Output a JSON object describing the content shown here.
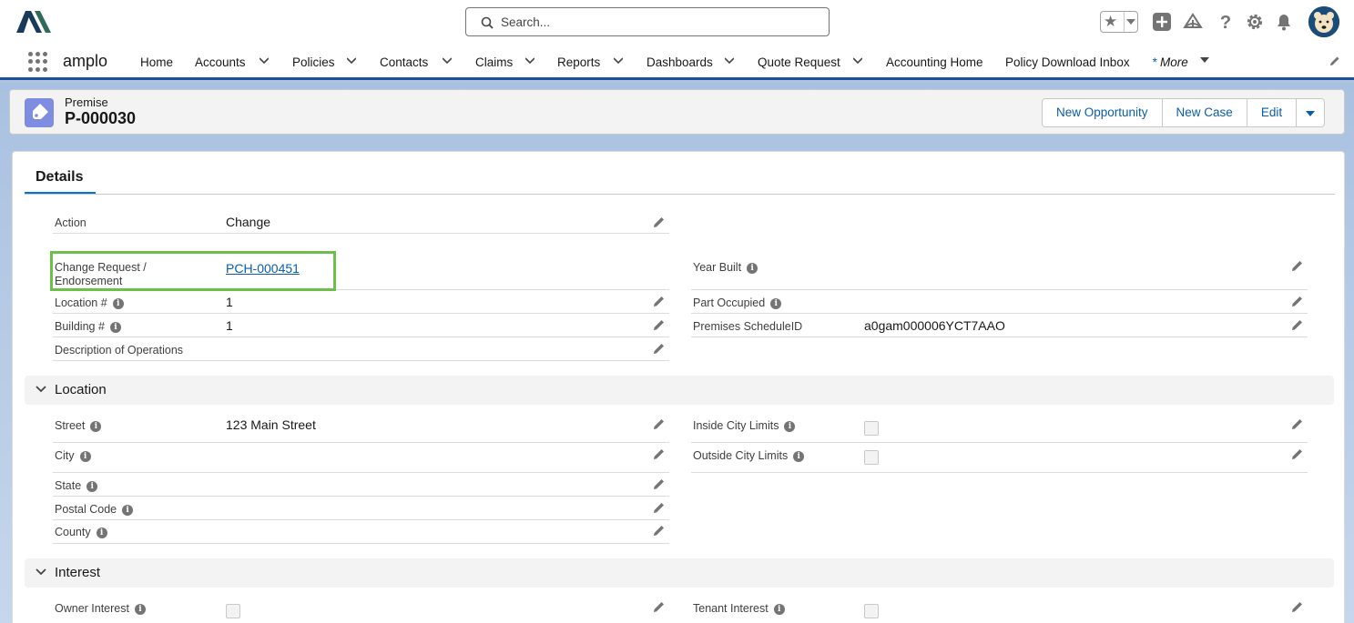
{
  "header": {
    "search_placeholder": "Search..."
  },
  "nav": {
    "app_name": "amplo",
    "items": [
      {
        "label": "Home"
      },
      {
        "label": "Accounts"
      },
      {
        "label": "Policies"
      },
      {
        "label": "Contacts"
      },
      {
        "label": "Claims"
      },
      {
        "label": "Reports"
      },
      {
        "label": "Dashboards"
      },
      {
        "label": "Quote Request"
      },
      {
        "label": "Accounting Home"
      },
      {
        "label": "Policy Download Inbox"
      }
    ],
    "more_star": "*",
    "more_label": "More"
  },
  "record": {
    "object_type": "Premise",
    "name": "P-000030",
    "buttons": {
      "new_opportunity": "New Opportunity",
      "new_case": "New Case",
      "edit": "Edit"
    }
  },
  "details": {
    "tab_label": "Details",
    "fields": {
      "action": {
        "label": "Action",
        "value": "Change"
      },
      "change_request": {
        "label_line1": "Change Request /",
        "label_line2": "Endorsement",
        "value": "PCH-000451"
      },
      "location_num": {
        "label": "Location #",
        "value": "1"
      },
      "building_num": {
        "label": "Building #",
        "value": "1"
      },
      "description": {
        "label": "Description of Operations",
        "value": ""
      },
      "year_built": {
        "label": "Year Built",
        "value": ""
      },
      "part_occupied": {
        "label": "Part Occupied",
        "value": ""
      },
      "premises_schedule": {
        "label": "Premises ScheduleID",
        "value": "a0gam000006YCT7AAO"
      }
    }
  },
  "location_section": {
    "title": "Location",
    "fields": {
      "street": {
        "label": "Street",
        "value": "123 Main Street"
      },
      "city": {
        "label": "City",
        "value": ""
      },
      "state": {
        "label": "State",
        "value": ""
      },
      "postal_code": {
        "label": "Postal Code",
        "value": ""
      },
      "county": {
        "label": "County",
        "value": ""
      },
      "inside_city_limits": {
        "label": "Inside City Limits",
        "checked": false
      },
      "outside_city_limits": {
        "label": "Outside City Limits",
        "checked": false
      }
    }
  },
  "interest_section": {
    "title": "Interest",
    "fields": {
      "owner_interest": {
        "label": "Owner Interest",
        "checked": false
      },
      "tenant_interest": {
        "label": "Tenant Interest",
        "checked": false
      }
    }
  },
  "colors": {
    "brand_blue": "#0b5cab",
    "nav_border": "#1b5297",
    "highlight_green": "#6cc04a",
    "premise_icon": "#7f8de1"
  }
}
